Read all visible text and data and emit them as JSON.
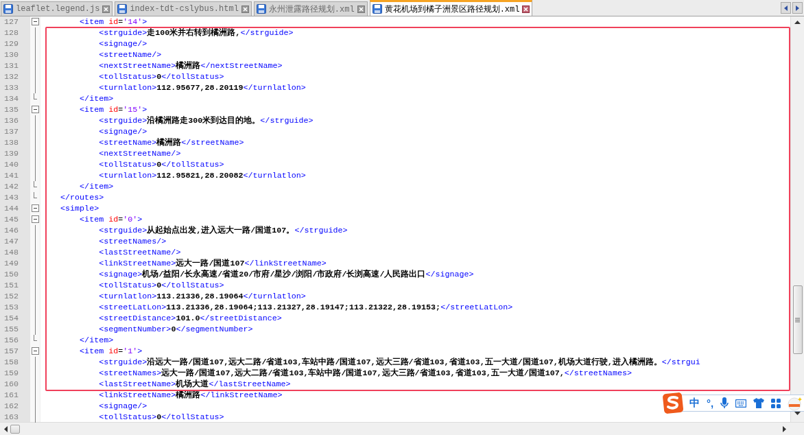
{
  "tabs": [
    {
      "label": "leaflet.legend.js",
      "selected": false
    },
    {
      "label": "index-tdt-cslybus.html",
      "selected": false
    },
    {
      "label": "永州泄露路径规划.xml",
      "selected": false
    },
    {
      "label": "黄花机场到橘子洲景区路径规划.xml",
      "selected": true
    }
  ],
  "editor": {
    "lines": [
      {
        "number": "127",
        "kind": "open",
        "tokens": [
          {
            "kind": "tag",
            "text": "        <item "
          },
          {
            "kind": "attr",
            "text": "id"
          },
          {
            "kind": "plain",
            "text": "="
          },
          {
            "kind": "value",
            "text": "'14'"
          },
          {
            "kind": "tag",
            "text": ">"
          }
        ]
      },
      {
        "number": "128",
        "kind": "line",
        "tokens": [
          {
            "kind": "tag",
            "text": "            <strguide>"
          },
          {
            "kind": "text",
            "text": "走100米并右转到橘洲路,"
          },
          {
            "kind": "tag",
            "text": "</strguide>"
          }
        ]
      },
      {
        "number": "129",
        "kind": "line",
        "tokens": [
          {
            "kind": "tag",
            "text": "            <signage/>"
          }
        ]
      },
      {
        "number": "130",
        "kind": "line",
        "tokens": [
          {
            "kind": "tag",
            "text": "            <streetName/>"
          }
        ]
      },
      {
        "number": "131",
        "kind": "line",
        "tokens": [
          {
            "kind": "tag",
            "text": "            <nextStreetName>"
          },
          {
            "kind": "text",
            "text": "橘洲路"
          },
          {
            "kind": "tag",
            "text": "</nextStreetName>"
          }
        ]
      },
      {
        "number": "132",
        "kind": "line",
        "tokens": [
          {
            "kind": "tag",
            "text": "            <tollStatus>"
          },
          {
            "kind": "text",
            "text": "0"
          },
          {
            "kind": "tag",
            "text": "</tollStatus>"
          }
        ]
      },
      {
        "number": "133",
        "kind": "line",
        "tokens": [
          {
            "kind": "tag",
            "text": "            <turnlatlon>"
          },
          {
            "kind": "text",
            "text": "112.95677,28.20119"
          },
          {
            "kind": "tag",
            "text": "</turnlatlon>"
          }
        ]
      },
      {
        "number": "134",
        "kind": "end",
        "tokens": [
          {
            "kind": "tag",
            "text": "        </item>"
          }
        ]
      },
      {
        "number": "135",
        "kind": "open",
        "tokens": [
          {
            "kind": "tag",
            "text": "        <item "
          },
          {
            "kind": "attr",
            "text": "id"
          },
          {
            "kind": "plain",
            "text": "="
          },
          {
            "kind": "value",
            "text": "'15'"
          },
          {
            "kind": "tag",
            "text": ">"
          }
        ]
      },
      {
        "number": "136",
        "kind": "line",
        "tokens": [
          {
            "kind": "tag",
            "text": "            <strguide>"
          },
          {
            "kind": "text",
            "text": "沿橘洲路走300米到达目的地。"
          },
          {
            "kind": "tag",
            "text": "</strguide>"
          }
        ]
      },
      {
        "number": "137",
        "kind": "line",
        "tokens": [
          {
            "kind": "tag",
            "text": "            <signage/>"
          }
        ]
      },
      {
        "number": "138",
        "kind": "line",
        "tokens": [
          {
            "kind": "tag",
            "text": "            <streetName>"
          },
          {
            "kind": "text",
            "text": "橘洲路"
          },
          {
            "kind": "tag",
            "text": "</streetName>"
          }
        ]
      },
      {
        "number": "139",
        "kind": "line",
        "tokens": [
          {
            "kind": "tag",
            "text": "            <nextStreetName/>"
          }
        ]
      },
      {
        "number": "140",
        "kind": "line",
        "tokens": [
          {
            "kind": "tag",
            "text": "            <tollStatus>"
          },
          {
            "kind": "text",
            "text": "0"
          },
          {
            "kind": "tag",
            "text": "</tollStatus>"
          }
        ]
      },
      {
        "number": "141",
        "kind": "line",
        "tokens": [
          {
            "kind": "tag",
            "text": "            <turnlatlon>"
          },
          {
            "kind": "text",
            "text": "112.95821,28.20082"
          },
          {
            "kind": "tag",
            "text": "</turnlatlon>"
          }
        ]
      },
      {
        "number": "142",
        "kind": "end",
        "tokens": [
          {
            "kind": "tag",
            "text": "        </item>"
          }
        ]
      },
      {
        "number": "143",
        "kind": "end",
        "tokens": [
          {
            "kind": "tag",
            "text": "    </routes>"
          }
        ]
      },
      {
        "number": "144",
        "kind": "open",
        "tokens": [
          {
            "kind": "tag",
            "text": "    <simple>"
          }
        ]
      },
      {
        "number": "145",
        "kind": "open",
        "tokens": [
          {
            "kind": "tag",
            "text": "        <item "
          },
          {
            "kind": "attr",
            "text": "id"
          },
          {
            "kind": "plain",
            "text": "="
          },
          {
            "kind": "value",
            "text": "'0'"
          },
          {
            "kind": "tag",
            "text": ">"
          }
        ]
      },
      {
        "number": "146",
        "kind": "line",
        "tokens": [
          {
            "kind": "tag",
            "text": "            <strguide>"
          },
          {
            "kind": "text",
            "text": "从起始点出发,进入远大一路/国道107。"
          },
          {
            "kind": "tag",
            "text": "</strguide>"
          }
        ]
      },
      {
        "number": "147",
        "kind": "line",
        "tokens": [
          {
            "kind": "tag",
            "text": "            <streetNames/>"
          }
        ]
      },
      {
        "number": "148",
        "kind": "line",
        "tokens": [
          {
            "kind": "tag",
            "text": "            <lastStreetName/>"
          }
        ]
      },
      {
        "number": "149",
        "kind": "line",
        "tokens": [
          {
            "kind": "tag",
            "text": "            <linkStreetName>"
          },
          {
            "kind": "text",
            "text": "远大一路/国道107"
          },
          {
            "kind": "tag",
            "text": "</linkStreetName>"
          }
        ]
      },
      {
        "number": "150",
        "kind": "line",
        "tokens": [
          {
            "kind": "tag",
            "text": "            <signage>"
          },
          {
            "kind": "text",
            "text": "机场/益阳/长永高速/省道20/市府/星沙/浏阳/市政府/长浏高速/人民路出口"
          },
          {
            "kind": "tag",
            "text": "</signage>"
          }
        ]
      },
      {
        "number": "151",
        "kind": "line",
        "tokens": [
          {
            "kind": "tag",
            "text": "            <tollStatus>"
          },
          {
            "kind": "text",
            "text": "0"
          },
          {
            "kind": "tag",
            "text": "</tollStatus>"
          }
        ]
      },
      {
        "number": "152",
        "kind": "line",
        "tokens": [
          {
            "kind": "tag",
            "text": "            <turnlatlon>"
          },
          {
            "kind": "text",
            "text": "113.21336,28.19064"
          },
          {
            "kind": "tag",
            "text": "</turnlatlon>"
          }
        ]
      },
      {
        "number": "153",
        "kind": "line",
        "tokens": [
          {
            "kind": "tag",
            "text": "            <streetLatLon>"
          },
          {
            "kind": "text",
            "text": "113.21336,28.19064;113.21327,28.19147;113.21322,28.19153;"
          },
          {
            "kind": "tag",
            "text": "</streetLatLon>"
          }
        ]
      },
      {
        "number": "154",
        "kind": "line",
        "tokens": [
          {
            "kind": "tag",
            "text": "            <streetDistance>"
          },
          {
            "kind": "text",
            "text": "101.0"
          },
          {
            "kind": "tag",
            "text": "</streetDistance>"
          }
        ]
      },
      {
        "number": "155",
        "kind": "line",
        "tokens": [
          {
            "kind": "tag",
            "text": "            <segmentNumber>"
          },
          {
            "kind": "text",
            "text": "0"
          },
          {
            "kind": "tag",
            "text": "</segmentNumber>"
          }
        ]
      },
      {
        "number": "156",
        "kind": "end",
        "tokens": [
          {
            "kind": "tag",
            "text": "        </item>"
          }
        ]
      },
      {
        "number": "157",
        "kind": "open",
        "tokens": [
          {
            "kind": "tag",
            "text": "        <item "
          },
          {
            "kind": "attr",
            "text": "id"
          },
          {
            "kind": "plain",
            "text": "="
          },
          {
            "kind": "value",
            "text": "'1'"
          },
          {
            "kind": "tag",
            "text": ">"
          }
        ]
      },
      {
        "number": "158",
        "kind": "line",
        "tokens": [
          {
            "kind": "tag",
            "text": "            <strguide>"
          },
          {
            "kind": "text",
            "text": "沿远大一路/国道107,远大二路/省道103,车站中路/国道107,远大三路/省道103,省道103,五一大道/国道107,机场大道行驶,进入橘洲路。"
          },
          {
            "kind": "tag",
            "text": "</strgui"
          }
        ]
      },
      {
        "number": "159",
        "kind": "line",
        "tokens": [
          {
            "kind": "tag",
            "text": "            <streetNames>"
          },
          {
            "kind": "text",
            "text": "远大一路/国道107,远大二路/省道103,车站中路/国道107,远大三路/省道103,省道103,五一大道/国道107,"
          },
          {
            "kind": "tag",
            "text": "</streetNames>"
          }
        ]
      },
      {
        "number": "160",
        "kind": "line",
        "tokens": [
          {
            "kind": "tag",
            "text": "            <lastStreetName>"
          },
          {
            "kind": "text",
            "text": "机场大道"
          },
          {
            "kind": "tag",
            "text": "</lastStreetName>"
          }
        ]
      },
      {
        "number": "161",
        "kind": "line",
        "tokens": [
          {
            "kind": "tag",
            "text": "            <linkStreetName>"
          },
          {
            "kind": "text",
            "text": "橘洲路"
          },
          {
            "kind": "tag",
            "text": "</linkStreetName>"
          }
        ]
      },
      {
        "number": "162",
        "kind": "line",
        "tokens": [
          {
            "kind": "tag",
            "text": "            <signage/>"
          }
        ]
      },
      {
        "number": "163",
        "kind": "line",
        "tokens": [
          {
            "kind": "tag",
            "text": "            <tollStatus>"
          },
          {
            "kind": "text",
            "text": "0"
          },
          {
            "kind": "tag",
            "text": "</tollStatus>"
          }
        ]
      }
    ]
  },
  "ime_toolbar": {
    "items": [
      {
        "kind": "logo"
      },
      {
        "kind": "label",
        "text": "中"
      },
      {
        "kind": "label",
        "text": "°,"
      },
      {
        "kind": "mic"
      },
      {
        "kind": "keyboard"
      },
      {
        "kind": "shirt"
      },
      {
        "kind": "grid"
      },
      {
        "kind": "mascot"
      }
    ]
  }
}
